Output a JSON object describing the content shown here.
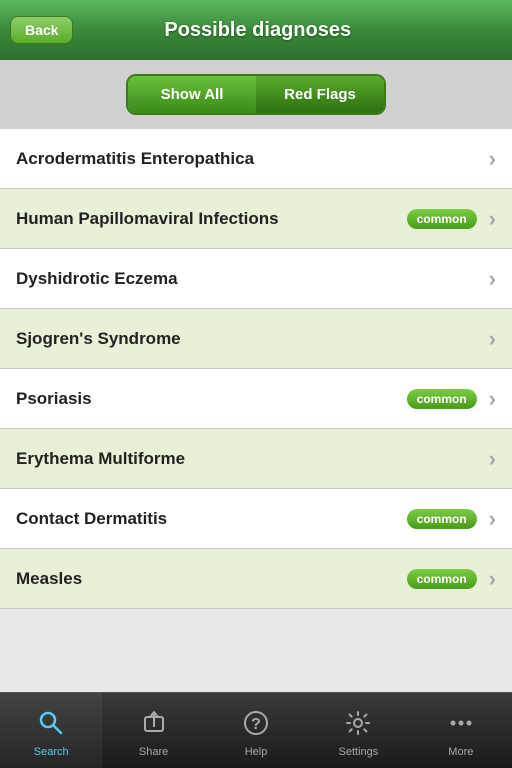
{
  "header": {
    "back_label": "Back",
    "title": "Possible diagnoses"
  },
  "toggle": {
    "show_all_label": "Show All",
    "red_flags_label": "Red Flags"
  },
  "diagnoses": [
    {
      "name": "Acrodermatitis Enteropathica",
      "common": false
    },
    {
      "name": "Human Papillomaviral Infections",
      "common": true
    },
    {
      "name": "Dyshidrotic Eczema",
      "common": false
    },
    {
      "name": "Sjogren's Syndrome",
      "common": false
    },
    {
      "name": "Psoriasis",
      "common": true
    },
    {
      "name": "Erythema Multiforme",
      "common": false
    },
    {
      "name": "Contact Dermatitis",
      "common": true
    },
    {
      "name": "Measles",
      "common": true
    }
  ],
  "tabs": [
    {
      "id": "search",
      "label": "Search",
      "icon": "🔍",
      "active": true
    },
    {
      "id": "share",
      "label": "Share",
      "icon": "↗",
      "active": false
    },
    {
      "id": "help",
      "label": "Help",
      "icon": "?",
      "active": false
    },
    {
      "id": "settings",
      "label": "Settings",
      "icon": "⚙",
      "active": false
    },
    {
      "id": "more",
      "label": "More",
      "icon": "···",
      "active": false
    }
  ],
  "common_badge_label": "common"
}
